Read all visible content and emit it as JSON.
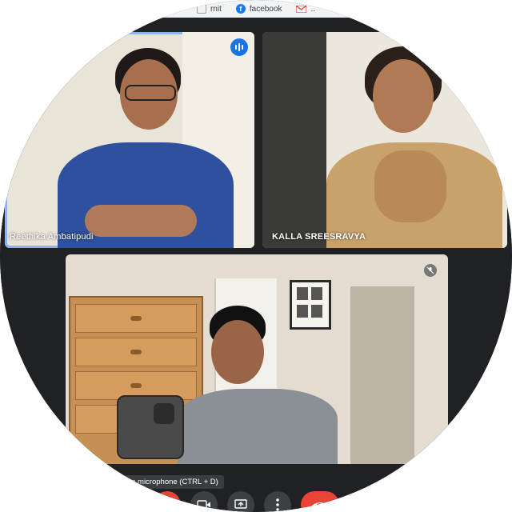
{
  "browser": {
    "bookmarks": [
      {
        "label": "rnit",
        "icon": "generic-icon"
      },
      {
        "label": "facebook",
        "icon": "facebook-icon"
      },
      {
        "label": "..",
        "icon": "gmail-icon"
      }
    ]
  },
  "meeting": {
    "participants": [
      {
        "name": "Reethika Ambatipudi",
        "state": "speaking",
        "icon": "audio-level-icon"
      },
      {
        "name": "KALLA SREESRAVYA",
        "state": "normal"
      },
      {
        "name": "",
        "state": "muted",
        "icon": "mic-off-icon"
      }
    ],
    "tooltip": "Turn on microphone (CTRL + D)",
    "controls": [
      {
        "name": "microphone",
        "icon": "mic-off-icon",
        "color": "#ea4335"
      },
      {
        "name": "camera",
        "icon": "camera-icon"
      },
      {
        "name": "present",
        "icon": "present-screen-icon"
      },
      {
        "name": "more",
        "icon": "more-options-icon"
      },
      {
        "name": "leave",
        "icon": "end-call-icon",
        "color": "#ea4335"
      }
    ],
    "accent": "#1a73e8"
  }
}
